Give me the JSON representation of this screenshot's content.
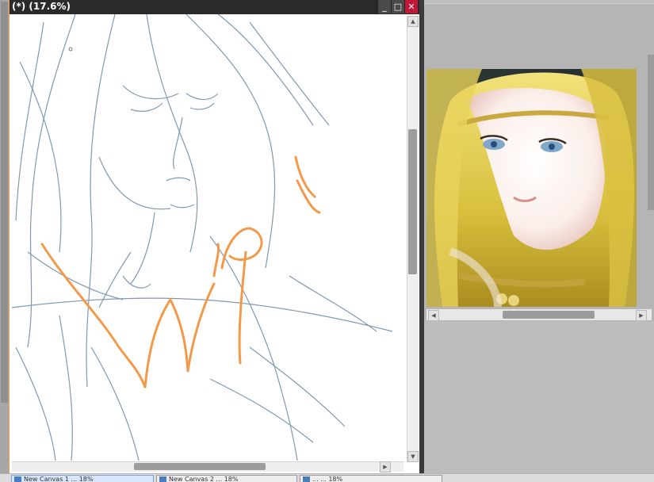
{
  "canvas_window": {
    "title": "(*) (17.6%)",
    "buttons": {
      "minimize": "_",
      "maximize": "□",
      "close": "✕"
    }
  },
  "annotation": {
    "text": "WIP"
  },
  "scroll": {
    "up": "▲",
    "down": "▼",
    "left": "◀",
    "right": "▶"
  },
  "tabs": [
    {
      "label": "New Canvas 1 ... 18%",
      "active": true
    },
    {
      "label": "New Canvas 2 ... 18%",
      "active": false
    },
    {
      "label": "... ... 18%",
      "active": false
    }
  ],
  "colors": {
    "accent": "#f29a4a",
    "sketch": "#6f8fae",
    "close": "#c2163b",
    "hair": "#e2c84a"
  }
}
